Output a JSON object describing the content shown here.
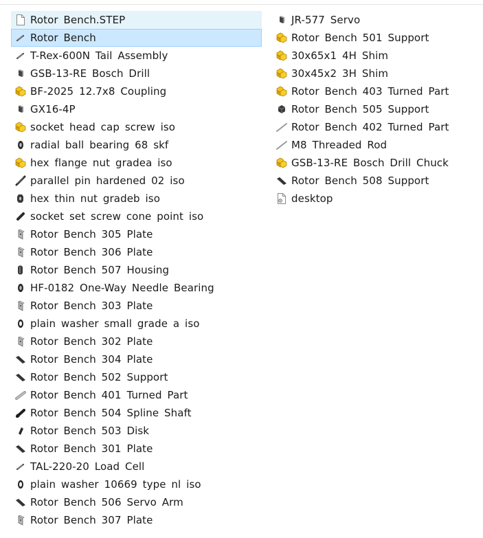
{
  "left_items": [
    {
      "label": "Rotor Bench.STEP",
      "icon": "document-icon",
      "state": "hover"
    },
    {
      "label": "Rotor Bench",
      "icon": "part-thin-icon",
      "state": "selected"
    },
    {
      "label": "T-Rex-600N Tail Assembly",
      "icon": "part-thin-icon"
    },
    {
      "label": "GSB-13-RE Bosch Drill",
      "icon": "part-small-icon"
    },
    {
      "label": "BF-2025 12.7x8 Coupling",
      "icon": "assembly-icon"
    },
    {
      "label": "GX16-4P",
      "icon": "part-small-icon"
    },
    {
      "label": "socket head cap screw iso",
      "icon": "assembly-icon"
    },
    {
      "label": "radial ball bearing 68 skf",
      "icon": "bearing-icon"
    },
    {
      "label": "hex flange nut gradea iso",
      "icon": "assembly-icon"
    },
    {
      "label": "parallel pin hardened 02 iso",
      "icon": "pin-icon"
    },
    {
      "label": "hex thin nut gradeb iso",
      "icon": "nut-icon"
    },
    {
      "label": "socket set screw cone point iso",
      "icon": "screw-icon"
    },
    {
      "label": "Rotor Bench 305 Plate",
      "icon": "plate-light-icon"
    },
    {
      "label": "Rotor Bench 306 Plate",
      "icon": "plate-light-icon"
    },
    {
      "label": "Rotor Bench 507 Housing",
      "icon": "housing-icon"
    },
    {
      "label": "HF-0182 One-Way Needle Bearing",
      "icon": "bearing-icon"
    },
    {
      "label": "Rotor Bench 303 Plate",
      "icon": "plate-light-icon"
    },
    {
      "label": "plain washer small grade a iso",
      "icon": "washer-icon"
    },
    {
      "label": "Rotor Bench 302 Plate",
      "icon": "plate-light-icon"
    },
    {
      "label": "Rotor Bench 304 Plate",
      "icon": "bar-icon"
    },
    {
      "label": "Rotor Bench 502 Support",
      "icon": "bar-icon"
    },
    {
      "label": "Rotor Bench 401 Turned Part",
      "icon": "rod-gray-icon"
    },
    {
      "label": "Rotor Bench 504 Spline Shaft",
      "icon": "shaft-icon"
    },
    {
      "label": "Rotor Bench 503 Disk",
      "icon": "disk-icon"
    },
    {
      "label": "Rotor Bench 301 Plate",
      "icon": "bar-icon"
    },
    {
      "label": "TAL-220-20 Load Cell",
      "icon": "part-thin-icon"
    },
    {
      "label": "plain washer 10669 type nl iso",
      "icon": "washer-icon"
    },
    {
      "label": "Rotor Bench 506 Servo Arm",
      "icon": "bar-icon"
    },
    {
      "label": "Rotor Bench 307 Plate",
      "icon": "plate-light-icon"
    }
  ],
  "right_items": [
    {
      "label": "JR-577 Servo",
      "icon": "part-small-icon"
    },
    {
      "label": "Rotor Bench 501 Support",
      "icon": "assembly-icon"
    },
    {
      "label": "30x65x1 4H Shim",
      "icon": "assembly-icon"
    },
    {
      "label": "30x45x2 3H Shim",
      "icon": "assembly-icon"
    },
    {
      "label": "Rotor Bench 403 Turned Part",
      "icon": "assembly-icon"
    },
    {
      "label": "Rotor Bench 505 Support",
      "icon": "block-icon"
    },
    {
      "label": "Rotor Bench 402 Turned Part",
      "icon": "rod-thin-icon"
    },
    {
      "label": "M8 Threaded Rod",
      "icon": "rod-thin-icon"
    },
    {
      "label": "GSB-13-RE Bosch Drill Chuck",
      "icon": "assembly-icon"
    },
    {
      "label": "Rotor Bench 508 Support",
      "icon": "bar-icon"
    },
    {
      "label": "desktop",
      "icon": "desktop-file-icon"
    }
  ],
  "colors": {
    "selected_bg": "#cce8ff",
    "selected_border": "#99d1ff",
    "hover_bg": "#e5f3fb",
    "assembly_yellow": "#f5c518"
  }
}
